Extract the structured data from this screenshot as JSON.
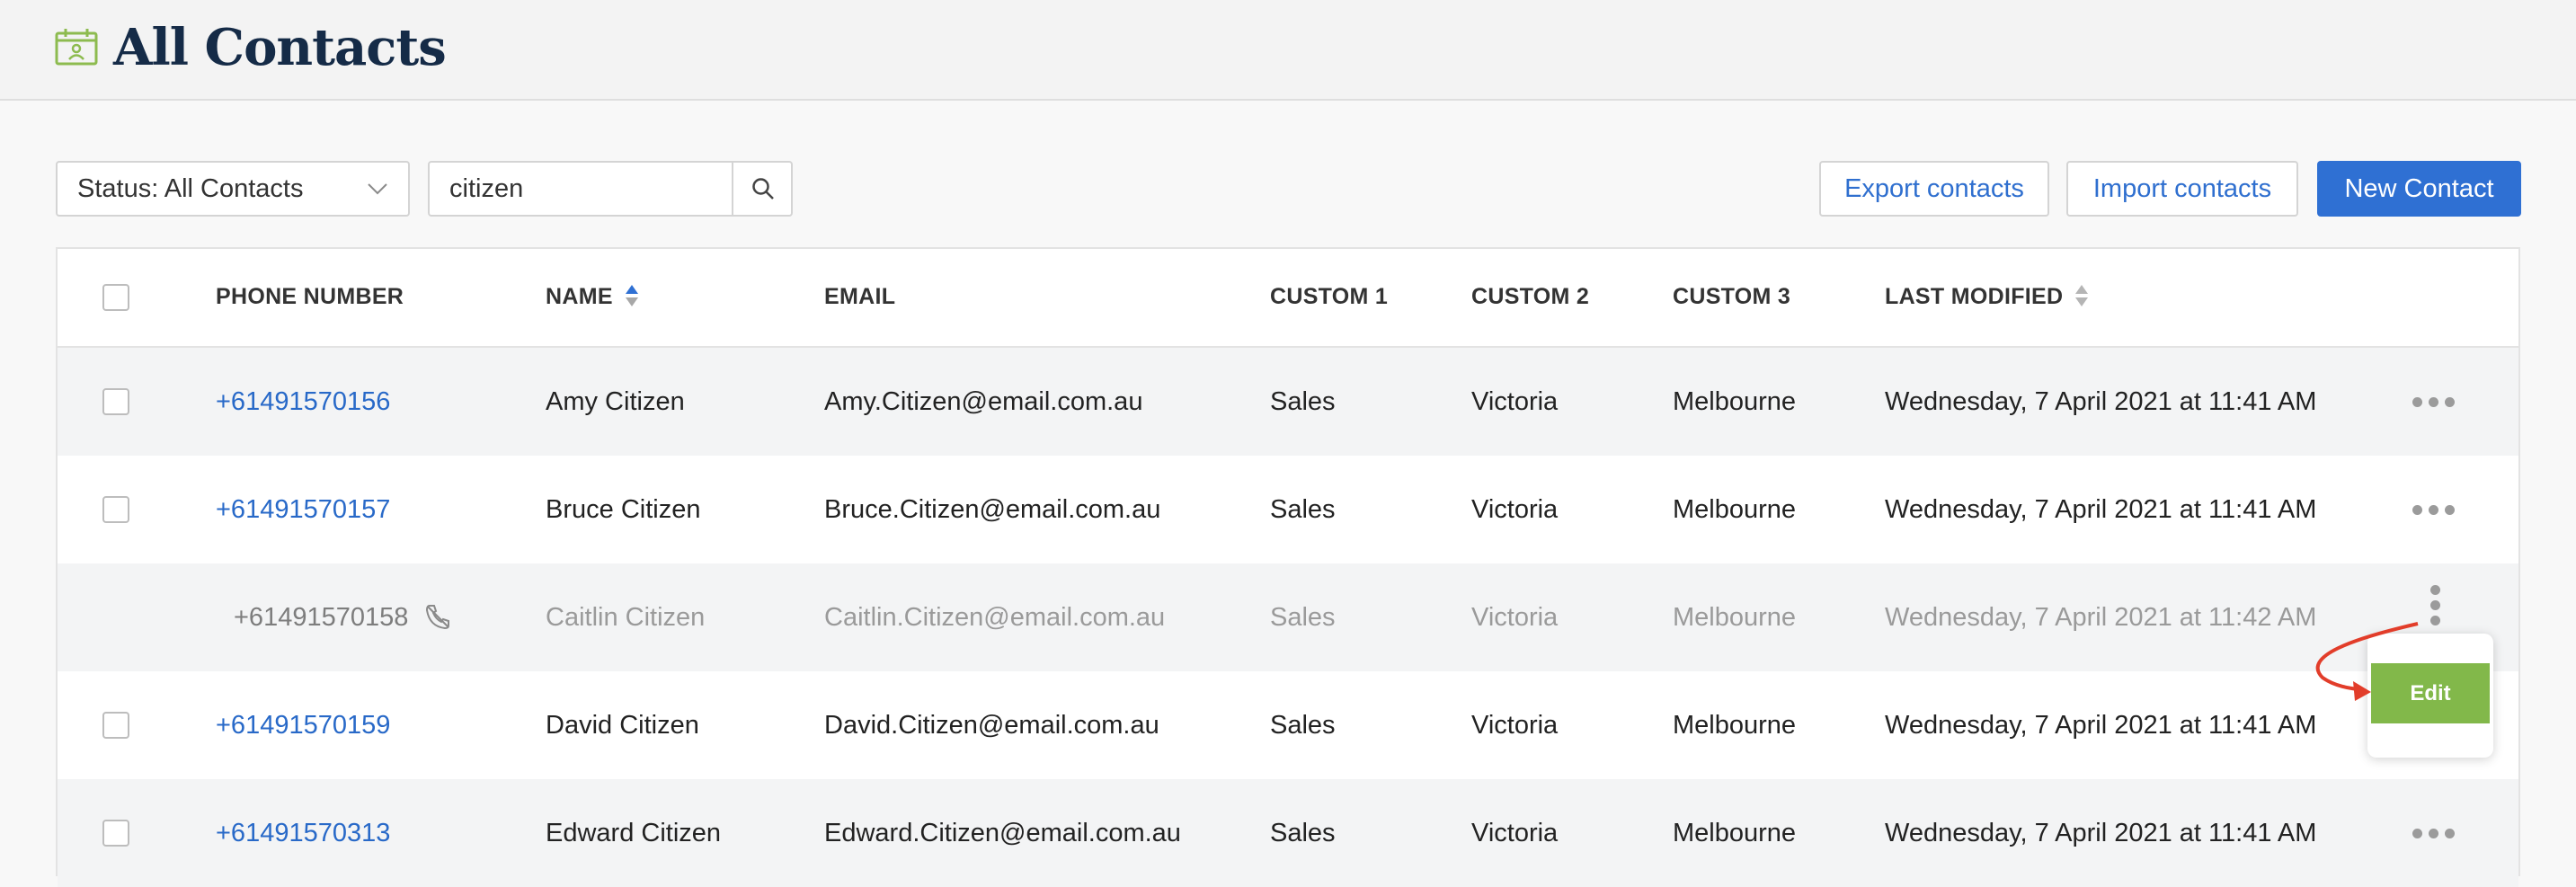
{
  "header": {
    "title": "All Contacts",
    "icon": "calendar-contact-icon"
  },
  "toolbar": {
    "status_filter": "Status: All Contacts",
    "search_value": "citizen",
    "export_label": "Export contacts",
    "import_label": "Import contacts",
    "new_label": "New Contact"
  },
  "table": {
    "headers": {
      "phone": "PHONE NUMBER",
      "name": "NAME",
      "email": "EMAIL",
      "custom1": "CUSTOM 1",
      "custom2": "CUSTOM 2",
      "custom3": "CUSTOM 3",
      "modified": "LAST MODIFIED"
    },
    "rows": [
      {
        "phone": "+61491570156",
        "name": "Amy Citizen",
        "email": "Amy.Citizen@email.com.au",
        "custom1": "Sales",
        "custom2": "Victoria",
        "custom3": "Melbourne",
        "modified": "Wednesday, 7 April 2021 at 11:41 AM"
      },
      {
        "phone": "+61491570157",
        "name": "Bruce Citizen",
        "email": "Bruce.Citizen@email.com.au",
        "custom1": "Sales",
        "custom2": "Victoria",
        "custom3": "Melbourne",
        "modified": "Wednesday, 7 April 2021 at 11:41 AM"
      },
      {
        "phone": "+61491570158",
        "name": "Caitlin Citizen",
        "email": "Caitlin.Citizen@email.com.au",
        "custom1": "Sales",
        "custom2": "Victoria",
        "custom3": "Melbourne",
        "modified": "Wednesday, 7 April 2021 at 11:42 AM"
      },
      {
        "phone": "+61491570159",
        "name": "David Citizen",
        "email": "David.Citizen@email.com.au",
        "custom1": "Sales",
        "custom2": "Victoria",
        "custom3": "Melbourne",
        "modified": "Wednesday, 7 April 2021 at 11:41 AM"
      },
      {
        "phone": "+61491570313",
        "name": "Edward Citizen",
        "email": "Edward.Citizen@email.com.au",
        "custom1": "Sales",
        "custom2": "Victoria",
        "custom3": "Melbourne",
        "modified": "Wednesday, 7 April 2021 at 11:41 AM"
      }
    ]
  },
  "row_menu": {
    "edit_label": "Edit"
  },
  "colors": {
    "accent": "#2f70d3",
    "link": "#2869c8",
    "edit_green": "#82b84a",
    "title": "#152b47",
    "annotation_arrow": "#e23d2a"
  }
}
